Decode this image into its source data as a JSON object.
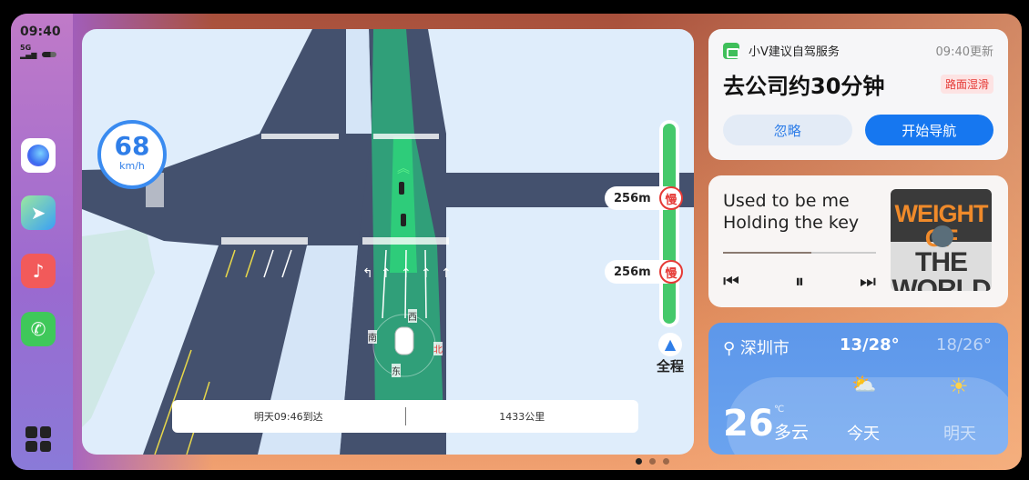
{
  "status": {
    "time": "09:40",
    "network": "5G"
  },
  "sidebar": {
    "apps": [
      {
        "icon": "assistant-bubble-icon"
      },
      {
        "icon": "paper-plane-icon"
      },
      {
        "icon": "music-note-icon"
      },
      {
        "icon": "phone-icon"
      },
      {
        "icon": "app-grid-icon"
      }
    ]
  },
  "map": {
    "speed": "68",
    "speed_unit": "km/h",
    "markers": [
      {
        "distance": "256m",
        "label": "慢"
      },
      {
        "distance": "256m",
        "label": "慢"
      }
    ],
    "overview": "全程",
    "eta": "明天09:46到达",
    "distance": "1433公里",
    "compass": {
      "n": "北",
      "s": "南",
      "e": "东",
      "w": "西"
    },
    "route_color": "#2ecf78"
  },
  "suggestion": {
    "title": "小V建议自驾服务",
    "updated": "09:40更新",
    "headline": "去公司约30分钟",
    "warning": "路面湿滑",
    "ignore": "忽略",
    "start": "开始导航"
  },
  "music": {
    "lyric1": "Used to be me",
    "lyric2": "Holding the key",
    "progress": 0.58,
    "album_top": "WEIGHT OF",
    "album_bottom": "THE WORLD"
  },
  "weather": {
    "city": "深圳市",
    "today_range": "13/28°",
    "tomorrow_range": "18/26°",
    "temp": "26",
    "unit": "℃",
    "cond": "多云",
    "today": "今天",
    "tomorrow": "明天"
  },
  "pager": {
    "pages": 3,
    "active": 1
  }
}
